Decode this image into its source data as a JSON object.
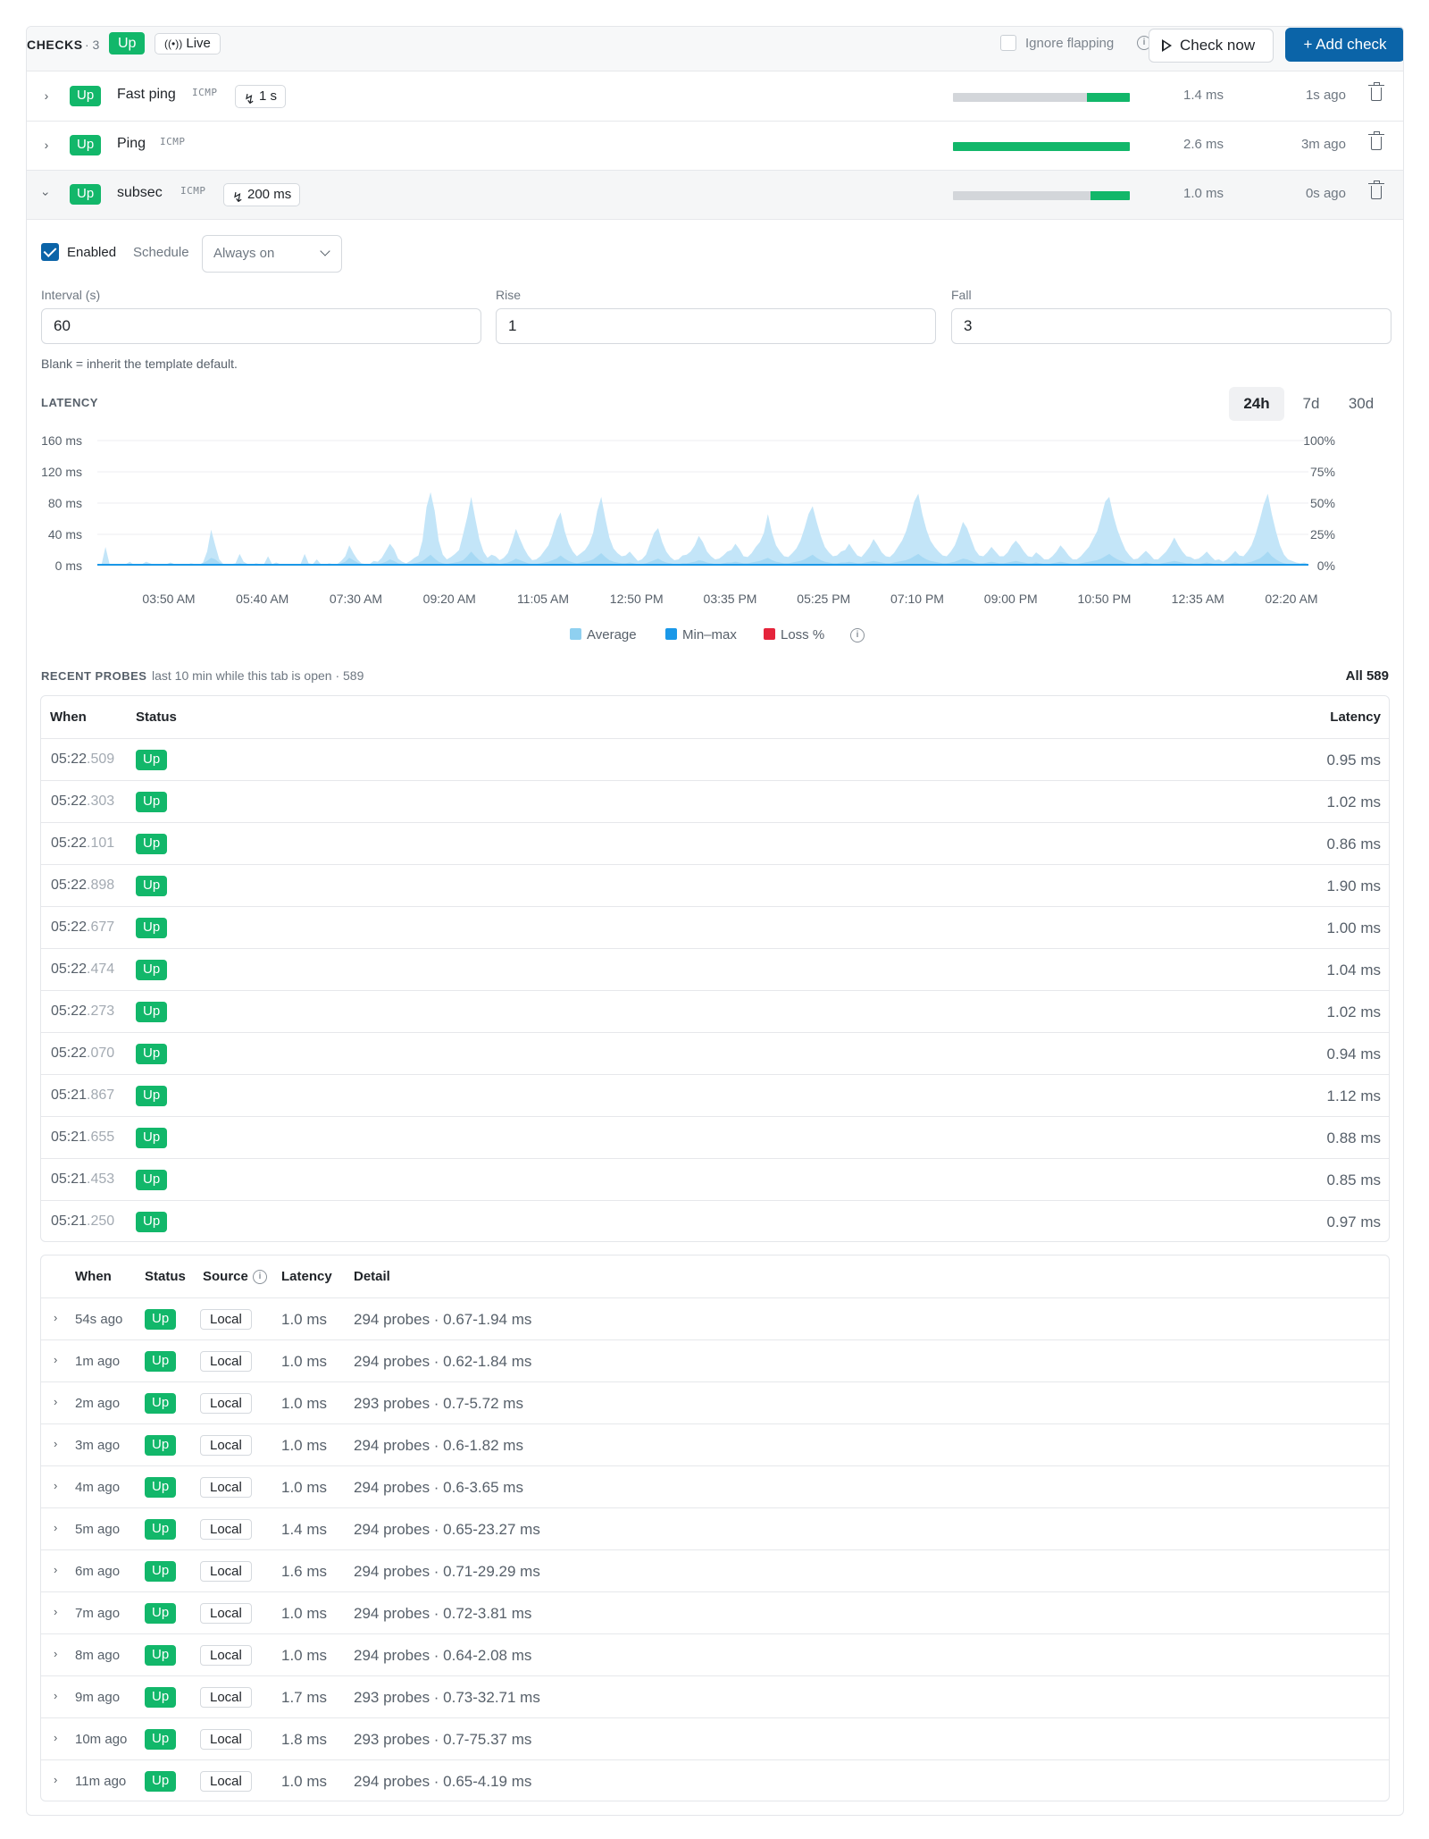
{
  "header": {
    "title": "CHECKS",
    "count": "· 3",
    "status": "Up",
    "live_label": "Live",
    "ignore_flapping_label": "Ignore flapping",
    "check_now_label": "Check now",
    "add_check_label": "+ Add check"
  },
  "checks": [
    {
      "status": "Up",
      "name": "Fast ping",
      "protocol": "ICMP",
      "interval": "1 s",
      "uptime_fraction": 0.24,
      "latency": "1.4 ms",
      "ago": "1s ago"
    },
    {
      "status": "Up",
      "name": "Ping",
      "protocol": "ICMP",
      "interval": "",
      "uptime_fraction": 1.0,
      "latency": "2.6 ms",
      "ago": "3m ago"
    },
    {
      "status": "Up",
      "name": "subsec",
      "protocol": "ICMP",
      "interval": "200 ms",
      "uptime_fraction": 0.22,
      "latency": "1.0 ms",
      "ago": "0s ago"
    }
  ],
  "settings": {
    "enabled_label": "Enabled",
    "schedule_label": "Schedule",
    "schedule_value": "Always on",
    "interval_label": "Interval (s)",
    "interval_value": "60",
    "rise_label": "Rise",
    "rise_value": "1",
    "fall_label": "Fall",
    "fall_value": "3",
    "hint": "Blank = inherit the template default."
  },
  "latency": {
    "section_label": "LATENCY",
    "ranges": [
      "24h",
      "7d",
      "30d"
    ],
    "active_range": "24h"
  },
  "chart_data": {
    "type": "area",
    "title": "",
    "xlabel": "",
    "ylabel": "",
    "y_ticks": [
      "160 ms",
      "120 ms",
      "80 ms",
      "40 ms",
      "0 ms"
    ],
    "y2_ticks": [
      "100%",
      "75%",
      "50%",
      "25%",
      "0%"
    ],
    "x_ticks": [
      "03:50 AM",
      "05:40 AM",
      "07:30 AM",
      "09:20 AM",
      "11:05 AM",
      "12:50 PM",
      "03:35 PM",
      "05:25 PM",
      "07:10 PM",
      "09:00 PM",
      "10:50 PM",
      "12:35 AM",
      "02:20 AM"
    ],
    "ylim": [
      0,
      160
    ],
    "y2lim": [
      0,
      100
    ],
    "grid": true,
    "legend_position": "bottom",
    "series": [
      {
        "name": "Average",
        "color": "#8fd0f0",
        "values": [
          1,
          1,
          2,
          1,
          2,
          1,
          2,
          1,
          1,
          1,
          2,
          1,
          1,
          2,
          1,
          1,
          1,
          2,
          3,
          2,
          1,
          2,
          1,
          2,
          1,
          1,
          3,
          6,
          10,
          8,
          4,
          1,
          1,
          2,
          2,
          3,
          2,
          1,
          1,
          2,
          1,
          1,
          2,
          1,
          2,
          1,
          1,
          2,
          1,
          1,
          1,
          2,
          1,
          1,
          2,
          1,
          1,
          2,
          1,
          1,
          3,
          5,
          10,
          7,
          4,
          2,
          1,
          1,
          2,
          2,
          3,
          5,
          8,
          6,
          3,
          2,
          1,
          2,
          3,
          4,
          6,
          10,
          14,
          9,
          5,
          3,
          2,
          3,
          4,
          5,
          7,
          12,
          18,
          12,
          7,
          4,
          3,
          4,
          3,
          2,
          3,
          4,
          6,
          9,
          7,
          5,
          3,
          2,
          2,
          3,
          4,
          5,
          7,
          9,
          13,
          9,
          6,
          4,
          3,
          4,
          5,
          6,
          8,
          12,
          16,
          11,
          7,
          5,
          4,
          3,
          3,
          4,
          3,
          2,
          2,
          3,
          5,
          7,
          9,
          6,
          4,
          3,
          2,
          2,
          3,
          3,
          4,
          5,
          7,
          6,
          4,
          3,
          2,
          2,
          3,
          4,
          4,
          5,
          4,
          3,
          3,
          4,
          5,
          6,
          8,
          10,
          7,
          5,
          4,
          3,
          3,
          4,
          5,
          6,
          8,
          11,
          14,
          10,
          7,
          5,
          4,
          3,
          3,
          4,
          4,
          5,
          4,
          3,
          3,
          4,
          5,
          6,
          5,
          4,
          3,
          3,
          4,
          5,
          6,
          7,
          9,
          12,
          15,
          11,
          8,
          6,
          5,
          4,
          3,
          3,
          4,
          5,
          7,
          9,
          8,
          6,
          4,
          3,
          3,
          4,
          5,
          4,
          3,
          3,
          4,
          5,
          6,
          5,
          4,
          3,
          3,
          4,
          3,
          2,
          2,
          3,
          4,
          5,
          4,
          3,
          2,
          2,
          3,
          4,
          5,
          6,
          7,
          9,
          12,
          15,
          11,
          8,
          6,
          4,
          3,
          2,
          2,
          3,
          4,
          3,
          2,
          2,
          3,
          4,
          5,
          6,
          5,
          4,
          3,
          3,
          2,
          2,
          3,
          4,
          3,
          2,
          2,
          1,
          2,
          3,
          4,
          3,
          3,
          4,
          5,
          7,
          9,
          13,
          18,
          12,
          8,
          5,
          3,
          2,
          2,
          1,
          1,
          2,
          1
        ]
      },
      {
        "name": "Min–max",
        "color": "#1a98e8",
        "values": [
          1,
          1,
          24,
          2,
          2,
          1,
          2,
          2,
          5,
          1,
          2,
          2,
          5,
          3,
          1,
          1,
          1,
          2,
          4,
          2,
          1,
          2,
          1,
          3,
          2,
          1,
          4,
          18,
          46,
          26,
          8,
          2,
          1,
          2,
          3,
          15,
          5,
          2,
          1,
          3,
          2,
          2,
          12,
          2,
          4,
          2,
          1,
          2,
          1,
          1,
          2,
          15,
          3,
          2,
          8,
          2,
          1,
          3,
          2,
          2,
          6,
          12,
          26,
          16,
          8,
          3,
          2,
          2,
          6,
          5,
          10,
          19,
          28,
          21,
          9,
          5,
          3,
          6,
          10,
          13,
          32,
          75,
          94,
          70,
          32,
          14,
          8,
          11,
          15,
          20,
          40,
          62,
          88,
          60,
          34,
          18,
          10,
          14,
          12,
          7,
          10,
          16,
          30,
          47,
          34,
          22,
          13,
          7,
          8,
          12,
          19,
          26,
          40,
          58,
          68,
          44,
          28,
          18,
          12,
          16,
          20,
          28,
          42,
          70,
          88,
          60,
          36,
          22,
          16,
          12,
          13,
          18,
          12,
          6,
          8,
          14,
          28,
          42,
          48,
          30,
          18,
          11,
          7,
          8,
          13,
          14,
          18,
          26,
          38,
          30,
          18,
          12,
          8,
          9,
          13,
          18,
          20,
          28,
          21,
          12,
          11,
          16,
          24,
          30,
          42,
          66,
          42,
          26,
          18,
          12,
          11,
          16,
          22,
          32,
          48,
          66,
          76,
          56,
          38,
          24,
          17,
          12,
          13,
          18,
          20,
          28,
          20,
          13,
          11,
          17,
          24,
          34,
          26,
          17,
          12,
          11,
          16,
          24,
          32,
          44,
          62,
          82,
          92,
          66,
          46,
          32,
          24,
          18,
          13,
          12,
          18,
          26,
          40,
          56,
          48,
          34,
          20,
          13,
          12,
          17,
          24,
          18,
          12,
          12,
          17,
          26,
          32,
          26,
          18,
          12,
          11,
          17,
          13,
          8,
          8,
          12,
          18,
          26,
          20,
          13,
          8,
          8,
          12,
          18,
          24,
          34,
          44,
          62,
          82,
          88,
          64,
          46,
          32,
          20,
          13,
          8,
          9,
          14,
          19,
          14,
          8,
          8,
          13,
          18,
          26,
          36,
          26,
          18,
          12,
          11,
          8,
          9,
          13,
          18,
          12,
          7,
          8,
          5,
          8,
          13,
          19,
          13,
          12,
          18,
          26,
          40,
          58,
          78,
          92,
          66,
          44,
          26,
          14,
          8,
          6,
          4,
          3,
          4,
          2
        ]
      },
      {
        "name": "Loss %",
        "color": "#e5243b",
        "values": [
          0,
          0,
          0,
          0,
          0,
          0,
          0,
          0,
          0,
          0,
          0,
          0,
          0,
          0,
          0,
          0,
          0,
          0,
          0,
          0,
          0,
          0,
          0,
          0,
          0,
          0,
          0,
          0,
          0,
          0,
          0,
          0,
          0,
          0,
          0,
          0,
          0,
          0,
          0,
          0,
          0,
          0,
          0,
          0,
          0,
          0,
          0,
          0,
          0,
          0,
          0,
          0,
          0,
          0,
          0,
          0,
          0,
          0,
          0,
          0,
          0,
          0,
          0,
          0,
          0,
          0,
          0,
          0,
          0,
          0,
          0,
          0,
          0,
          0,
          0,
          0,
          0,
          0,
          0,
          0,
          0,
          0,
          0,
          0,
          0,
          0,
          0,
          0,
          0,
          0,
          0,
          0,
          0,
          0,
          0,
          0,
          0,
          0,
          0,
          0,
          0,
          0,
          0,
          0,
          0,
          0,
          0,
          0,
          0,
          0,
          0,
          0,
          0,
          0,
          0,
          0,
          0,
          0,
          0,
          0,
          0,
          0,
          0,
          0,
          0,
          0,
          0,
          0,
          0,
          0,
          0,
          0,
          0,
          0,
          0,
          0,
          0,
          0,
          0,
          0,
          0,
          0,
          0,
          0,
          0,
          0,
          0,
          0,
          0,
          0,
          0,
          0,
          0,
          0,
          0,
          0,
          0,
          0,
          0,
          0,
          0,
          0,
          0,
          0,
          0,
          0,
          0,
          0,
          0,
          0,
          0,
          0,
          0,
          0,
          0,
          0,
          0,
          0,
          0,
          0,
          0,
          0,
          0,
          0,
          0,
          0,
          0,
          0,
          0,
          0,
          0,
          0,
          0,
          0,
          0,
          0,
          0,
          0,
          0,
          0,
          0,
          0,
          0,
          0,
          0,
          0,
          0,
          0,
          0,
          0,
          0,
          0,
          0,
          0,
          0,
          0,
          0,
          0,
          0,
          0,
          0,
          0,
          0,
          0,
          0,
          0,
          0,
          0,
          0,
          0,
          0,
          0,
          0,
          0,
          0,
          0,
          0,
          0,
          0,
          0,
          0,
          0,
          0,
          0,
          0,
          0,
          0,
          0,
          0,
          0,
          0,
          0,
          0,
          0,
          0,
          0,
          0,
          0,
          0,
          0,
          0,
          0,
          0,
          0,
          0,
          0,
          0,
          0,
          0,
          0,
          0,
          0,
          0,
          0,
          0,
          0,
          0,
          0,
          0,
          0,
          0,
          0,
          0,
          0,
          0,
          0,
          0,
          0,
          0,
          0,
          0,
          0,
          0,
          0,
          0,
          0,
          0
        ]
      }
    ]
  },
  "recent_probes": {
    "section_label": "RECENT PROBES",
    "subtitle": "last 10 min while this tab is open · 589",
    "all_label": "All 589",
    "columns": {
      "when": "When",
      "status": "Status",
      "latency": "Latency"
    },
    "rows": [
      {
        "time": "05:22",
        "ms": ".509",
        "status": "Up",
        "latency": "0.95 ms"
      },
      {
        "time": "05:22",
        "ms": ".303",
        "status": "Up",
        "latency": "1.02 ms"
      },
      {
        "time": "05:22",
        "ms": ".101",
        "status": "Up",
        "latency": "0.86 ms"
      },
      {
        "time": "05:22",
        "ms": ".898",
        "status": "Up",
        "latency": "1.90 ms"
      },
      {
        "time": "05:22",
        "ms": ".677",
        "status": "Up",
        "latency": "1.00 ms"
      },
      {
        "time": "05:22",
        "ms": ".474",
        "status": "Up",
        "latency": "1.04 ms"
      },
      {
        "time": "05:22",
        "ms": ".273",
        "status": "Up",
        "latency": "1.02 ms"
      },
      {
        "time": "05:22",
        "ms": ".070",
        "status": "Up",
        "latency": "0.94 ms"
      },
      {
        "time": "05:21",
        "ms": ".867",
        "status": "Up",
        "latency": "1.12 ms"
      },
      {
        "time": "05:21",
        "ms": ".655",
        "status": "Up",
        "latency": "0.88 ms"
      },
      {
        "time": "05:21",
        "ms": ".453",
        "status": "Up",
        "latency": "0.85 ms"
      },
      {
        "time": "05:21",
        "ms": ".250",
        "status": "Up",
        "latency": "0.97 ms"
      }
    ]
  },
  "history": {
    "columns": {
      "when": "When",
      "status": "Status",
      "source": "Source",
      "latency": "Latency",
      "detail": "Detail"
    },
    "rows": [
      {
        "ago": "54s ago",
        "status": "Up",
        "source": "Local",
        "latency": "1.0 ms",
        "detail": "294 probes · 0.67-1.94 ms"
      },
      {
        "ago": "1m ago",
        "status": "Up",
        "source": "Local",
        "latency": "1.0 ms",
        "detail": "294 probes · 0.62-1.84 ms"
      },
      {
        "ago": "2m ago",
        "status": "Up",
        "source": "Local",
        "latency": "1.0 ms",
        "detail": "293 probes · 0.7-5.72 ms"
      },
      {
        "ago": "3m ago",
        "status": "Up",
        "source": "Local",
        "latency": "1.0 ms",
        "detail": "294 probes · 0.6-1.82 ms"
      },
      {
        "ago": "4m ago",
        "status": "Up",
        "source": "Local",
        "latency": "1.0 ms",
        "detail": "294 probes · 0.6-3.65 ms"
      },
      {
        "ago": "5m ago",
        "status": "Up",
        "source": "Local",
        "latency": "1.4 ms",
        "detail": "294 probes · 0.65-23.27 ms"
      },
      {
        "ago": "6m ago",
        "status": "Up",
        "source": "Local",
        "latency": "1.6 ms",
        "detail": "294 probes · 0.71-29.29 ms"
      },
      {
        "ago": "7m ago",
        "status": "Up",
        "source": "Local",
        "latency": "1.0 ms",
        "detail": "294 probes · 0.72-3.81 ms"
      },
      {
        "ago": "8m ago",
        "status": "Up",
        "source": "Local",
        "latency": "1.0 ms",
        "detail": "294 probes · 0.64-2.08 ms"
      },
      {
        "ago": "9m ago",
        "status": "Up",
        "source": "Local",
        "latency": "1.7 ms",
        "detail": "293 probes · 0.73-32.71 ms"
      },
      {
        "ago": "10m ago",
        "status": "Up",
        "source": "Local",
        "latency": "1.8 ms",
        "detail": "293 probes · 0.7-75.37 ms"
      },
      {
        "ago": "11m ago",
        "status": "Up",
        "source": "Local",
        "latency": "1.0 ms",
        "detail": "294 probes · 0.65-4.19 ms"
      }
    ]
  },
  "colors": {
    "up": "#12b76a",
    "primary": "#0b64a8",
    "average_fill": "#8fd0f0",
    "minmax_fill": "#1a98e8",
    "loss": "#e5243b"
  }
}
